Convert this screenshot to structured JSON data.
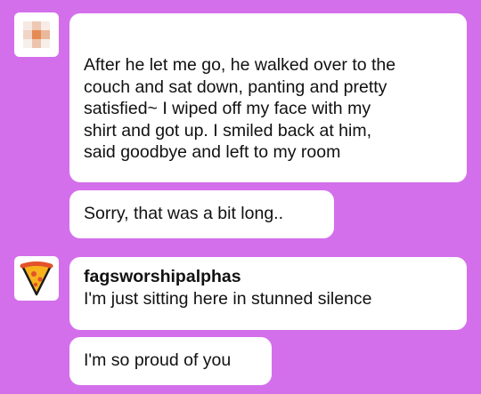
{
  "colors": {
    "background": "#d46fec",
    "bubble": "#ffffff",
    "text": "#111111"
  },
  "messages": [
    {
      "sender_avatar": "pixelated-avatar-icon",
      "lines": [
        "After he let me go, he walked over to the",
        "couch and sat down, panting and pretty",
        "satisfied~ I wiped off my face with my",
        "shirt and got up. I smiled back at him,",
        "said goodbye and left to my room"
      ]
    },
    {
      "lines": [
        "Sorry, that was a bit long.."
      ]
    },
    {
      "sender_avatar": "pizza-slice-icon",
      "username": "fagsworshipalphas",
      "lines": [
        "I'm just sitting here in stunned silence"
      ]
    },
    {
      "lines": [
        "I'm so proud of you"
      ]
    }
  ]
}
